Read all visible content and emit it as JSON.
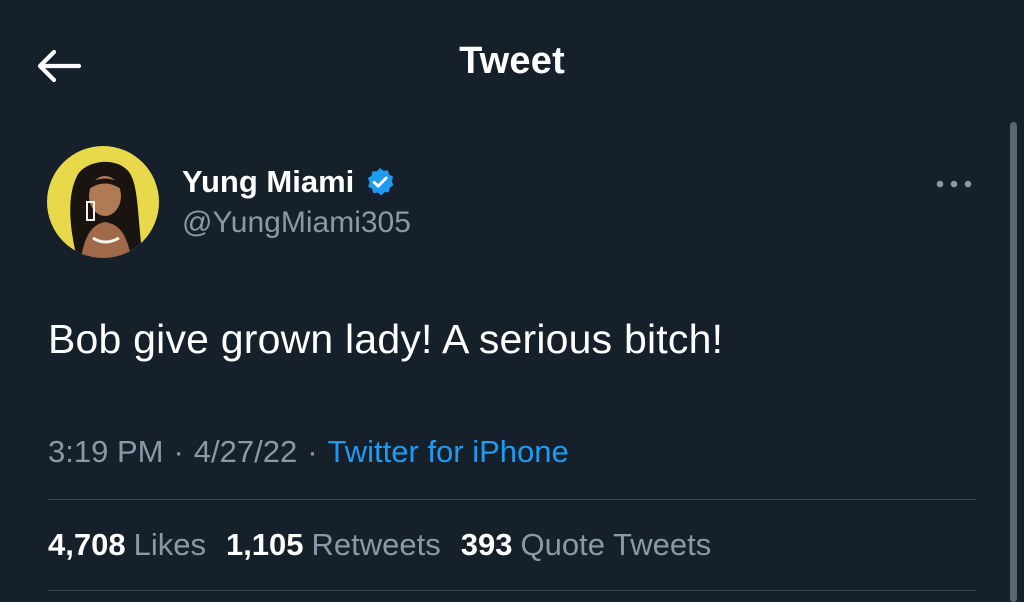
{
  "header": {
    "title": "Tweet",
    "back_icon": "arrow-left-icon"
  },
  "author": {
    "display_name": "Yung Miami",
    "handle": "@YungMiami305",
    "verified_icon": "verified-badge-icon",
    "avatar_icon": "avatar-image"
  },
  "tweet": {
    "text": "Bob give grown lady! A serious bitch!",
    "time": "3:19 PM",
    "separator": "·",
    "date": "4/27/22",
    "source": "Twitter for iPhone"
  },
  "stats": {
    "likes_count": "4,708",
    "likes_label": "Likes",
    "retweets_count": "1,105",
    "retweets_label": "Retweets",
    "quotes_count": "393",
    "quotes_label": "Quote Tweets"
  },
  "colors": {
    "background": "#15202b",
    "accent": "#1d9bf0",
    "muted_text": "#8b98a5",
    "divider": "#38444d",
    "avatar_bg": "#e8d94a"
  }
}
